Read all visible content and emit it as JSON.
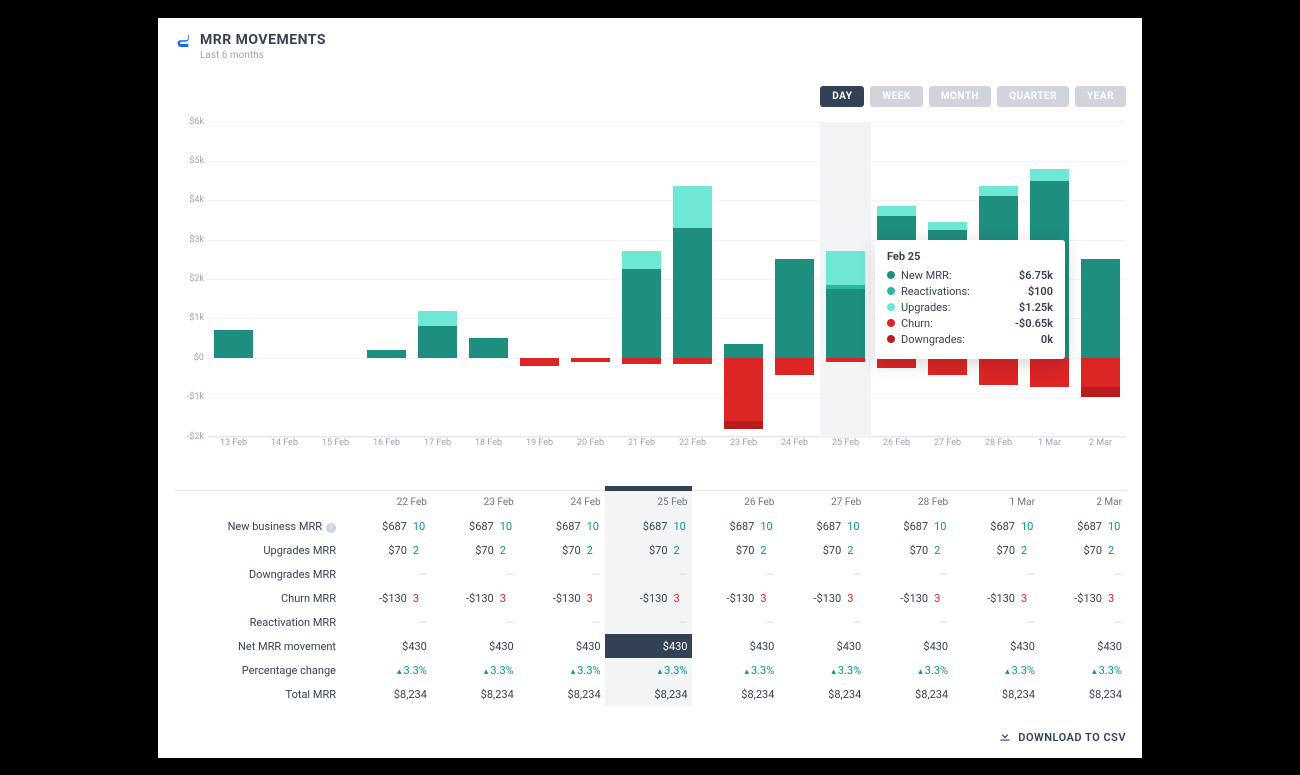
{
  "colors": {
    "new_mrr": "#1e8e7e",
    "reactivations": "#2fb5a0",
    "upgrades": "#6ee7d5",
    "churn": "#dc2626",
    "downgrades": "#b91c1c"
  },
  "header": {
    "title": "MRR MOVEMENTS",
    "subtitle": "Last 6 months"
  },
  "time_range": {
    "options": [
      "DAY",
      "WEEK",
      "MONTH",
      "QUARTER",
      "YEAR"
    ],
    "active": "DAY"
  },
  "tooltip": {
    "title": "Feb 25",
    "rows": [
      {
        "label": "New MRR:",
        "value": "$6.75k",
        "color_key": "new_mrr"
      },
      {
        "label": "Reactivations:",
        "value": "$100",
        "color_key": "reactivations"
      },
      {
        "label": "Upgrades:",
        "value": "$1.25k",
        "color_key": "upgrades"
      },
      {
        "label": "Churn:",
        "value": "-$0.65k",
        "color_key": "churn"
      },
      {
        "label": "Downgrades:",
        "value": "0k",
        "color_key": "downgrades"
      }
    ]
  },
  "chart_data": {
    "type": "bar",
    "ylabel": "",
    "ylim": [
      -2000,
      6000
    ],
    "y_ticks": [
      "-$2k",
      "-$1k",
      "$0",
      "$1k",
      "$2k",
      "$3k",
      "$4k",
      "$5k",
      "$6k"
    ],
    "categories": [
      "13 Feb",
      "14 Feb",
      "15 Feb",
      "16 Feb",
      "17 Feb",
      "18 Feb",
      "19 Feb",
      "20 Feb",
      "21 Feb",
      "22  Feb",
      "23 Feb",
      "24 Feb",
      "25 Feb",
      "26 Feb",
      "27 Feb",
      "28 Feb",
      "1 Mar",
      "2 Mar"
    ],
    "hovered_index": 12,
    "series": [
      {
        "name": "New MRR",
        "color_key": "new_mrr",
        "values": [
          700,
          0,
          0,
          200,
          800,
          500,
          0,
          0,
          2250,
          3300,
          350,
          2500,
          1750,
          3600,
          3250,
          4100,
          4500,
          2500
        ]
      },
      {
        "name": "Reactivations",
        "color_key": "reactivations",
        "values": [
          0,
          0,
          0,
          0,
          0,
          0,
          0,
          0,
          0,
          0,
          0,
          0,
          100,
          0,
          0,
          0,
          0,
          0
        ]
      },
      {
        "name": "Upgrades",
        "color_key": "upgrades",
        "values": [
          0,
          0,
          0,
          0,
          400,
          0,
          0,
          0,
          450,
          1050,
          0,
          0,
          850,
          250,
          200,
          250,
          300,
          0
        ]
      },
      {
        "name": "Churn",
        "color_key": "churn",
        "values": [
          0,
          0,
          0,
          0,
          0,
          0,
          -200,
          -100,
          -150,
          -150,
          -1600,
          -450,
          -100,
          -250,
          -450,
          -700,
          -750,
          -750
        ]
      },
      {
        "name": "Downgrades",
        "color_key": "downgrades",
        "values": [
          0,
          0,
          0,
          0,
          0,
          0,
          0,
          0,
          0,
          0,
          -200,
          0,
          0,
          0,
          0,
          0,
          0,
          -250
        ]
      }
    ]
  },
  "table": {
    "columns": [
      "22 Feb",
      "23 Feb",
      "24 Feb",
      "25 Feb",
      "26 Feb",
      "27 Feb",
      "28 Feb",
      "1 Mar",
      "2 Mar"
    ],
    "highlight_col": 3,
    "rows": [
      {
        "label": "New business MRR",
        "info": true,
        "cells": [
          {
            "v": "$687",
            "c": "10"
          },
          {
            "v": "$687",
            "c": "10"
          },
          {
            "v": "$687",
            "c": "10"
          },
          {
            "v": "$687",
            "c": "10"
          },
          {
            "v": "$687",
            "c": "10"
          },
          {
            "v": "$687",
            "c": "10"
          },
          {
            "v": "$687",
            "c": "10"
          },
          {
            "v": "$687",
            "c": "10"
          },
          {
            "v": "$687",
            "c": "10"
          }
        ]
      },
      {
        "label": "Upgrades MRR",
        "cells": [
          {
            "v": "$70",
            "c": "2"
          },
          {
            "v": "$70",
            "c": "2"
          },
          {
            "v": "$70",
            "c": "2"
          },
          {
            "v": "$70",
            "c": "2"
          },
          {
            "v": "$70",
            "c": "2"
          },
          {
            "v": "$70",
            "c": "2"
          },
          {
            "v": "$70",
            "c": "2"
          },
          {
            "v": "$70",
            "c": "2"
          },
          {
            "v": "$70",
            "c": "2"
          }
        ]
      },
      {
        "label": "Downgrades MRR",
        "cells": [
          {
            "v": "—"
          },
          {
            "v": "—"
          },
          {
            "v": "—"
          },
          {
            "v": "—"
          },
          {
            "v": "—"
          },
          {
            "v": "—"
          },
          {
            "v": "—"
          },
          {
            "v": "—"
          },
          {
            "v": "—"
          }
        ]
      },
      {
        "label": "Churn MRR",
        "cells": [
          {
            "v": "-$130",
            "c": "3",
            "neg": true
          },
          {
            "v": "-$130",
            "c": "3",
            "neg": true
          },
          {
            "v": "-$130",
            "c": "3",
            "neg": true
          },
          {
            "v": "-$130",
            "c": "3",
            "neg": true
          },
          {
            "v": "-$130",
            "c": "3",
            "neg": true
          },
          {
            "v": "-$130",
            "c": "3",
            "neg": true
          },
          {
            "v": "-$130",
            "c": "3",
            "neg": true
          },
          {
            "v": "-$130",
            "c": "3",
            "neg": true
          },
          {
            "v": "-$130",
            "c": "3",
            "neg": true
          }
        ]
      },
      {
        "label": "Reactivation MRR",
        "cells": [
          {
            "v": "—"
          },
          {
            "v": "—"
          },
          {
            "v": "—"
          },
          {
            "v": "—"
          },
          {
            "v": "—"
          },
          {
            "v": "—"
          },
          {
            "v": "—"
          },
          {
            "v": "—"
          },
          {
            "v": "—"
          }
        ]
      },
      {
        "label": "Net MRR movement",
        "net": true,
        "cells": [
          {
            "v": "$430"
          },
          {
            "v": "$430"
          },
          {
            "v": "$430"
          },
          {
            "v": "$430"
          },
          {
            "v": "$430"
          },
          {
            "v": "$430"
          },
          {
            "v": "$430"
          },
          {
            "v": "$430"
          },
          {
            "v": "$430"
          }
        ]
      },
      {
        "label": "Percentage change",
        "cells": [
          {
            "v": "3.3%",
            "pct": true
          },
          {
            "v": "3.3%",
            "pct": true
          },
          {
            "v": "3.3%",
            "pct": true
          },
          {
            "v": "3.3%",
            "pct": true
          },
          {
            "v": "3.3%",
            "pct": true
          },
          {
            "v": "3.3%",
            "pct": true
          },
          {
            "v": "3.3%",
            "pct": true
          },
          {
            "v": "3.3%",
            "pct": true
          },
          {
            "v": "3.3%",
            "pct": true
          }
        ]
      },
      {
        "label": "Total MRR",
        "cells": [
          {
            "v": "$8,234"
          },
          {
            "v": "$8,234"
          },
          {
            "v": "$8,234"
          },
          {
            "v": "$8,234"
          },
          {
            "v": "$8,234"
          },
          {
            "v": "$8,234"
          },
          {
            "v": "$8,234"
          },
          {
            "v": "$8,234"
          },
          {
            "v": "$8,234"
          }
        ]
      }
    ]
  },
  "download_label": "DOWNLOAD TO CSV"
}
